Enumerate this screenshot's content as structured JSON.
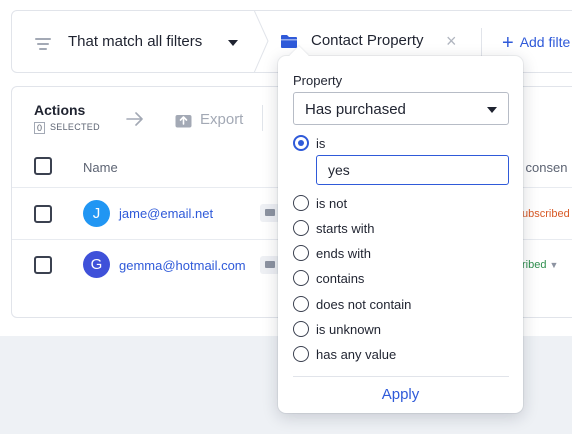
{
  "filter_bar": {
    "match_label": "That match all filters",
    "contact_property_label": "Contact Property",
    "add_filter_label": "Add filte"
  },
  "actions": {
    "title": "Actions",
    "selected_count": "0",
    "selected_label": "SELECTED",
    "export_label": "Export"
  },
  "table": {
    "columns": {
      "name": "Name",
      "consent": "l consen"
    },
    "rows": [
      {
        "avatar_letter": "J",
        "avatar_color": "#2196f3",
        "email": "jame@email.net",
        "status": "ubscribed",
        "status_color": "#d85a27"
      },
      {
        "avatar_letter": "G",
        "avatar_color": "#3f51d9",
        "email": "gemma@hotmail.com",
        "status": "ribed",
        "status_color": "#2f8f4e"
      }
    ]
  },
  "popover": {
    "property_label": "Property",
    "property_value": "Has purchased",
    "operators": [
      "is",
      "is not",
      "starts with",
      "ends with",
      "contains",
      "does not contain",
      "is unknown",
      "has any value"
    ],
    "selected_operator": "is",
    "value_input": "yes",
    "apply_label": "Apply"
  },
  "colors": {
    "accent": "#2f5ad9",
    "unsubscribed": "#d85a27",
    "subscribed": "#2f8f4e"
  },
  "icons": [
    "filter-lines-icon",
    "folder-icon",
    "close-icon",
    "plus-icon",
    "arrow-right-icon",
    "export-icon",
    "mail-icon",
    "chevron-down-icon"
  ]
}
